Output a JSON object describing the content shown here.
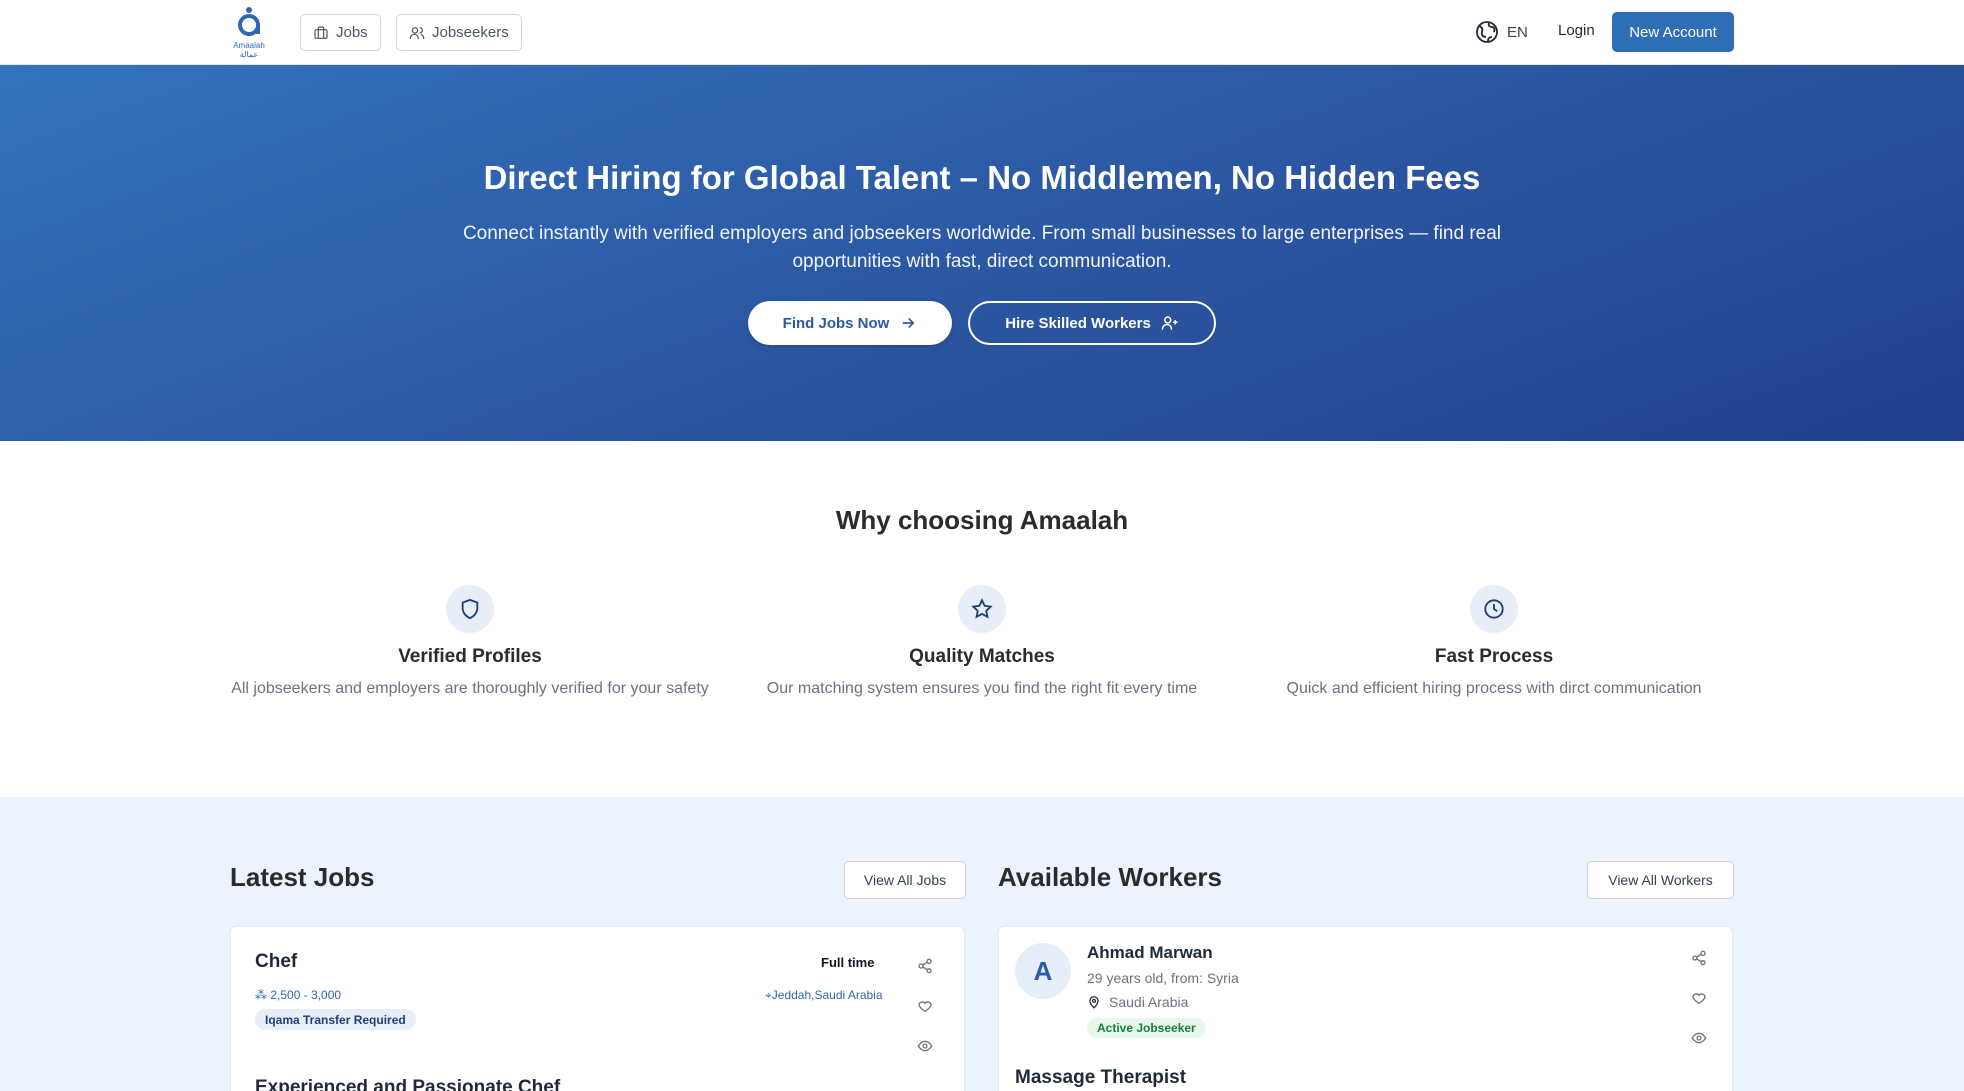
{
  "nav": {
    "logo_text_en": "Amaalah",
    "logo_text_ar": "عمالة",
    "jobs_label": "Jobs",
    "jobseekers_label": "Jobseekers",
    "language": "EN",
    "login_label": "Login",
    "new_account_label": "New Account"
  },
  "hero": {
    "title": "Direct Hiring for Global Talent – No Middlemen, No Hidden Fees",
    "subtitle": "Connect instantly with verified employers and jobseekers worldwide. From small businesses to large enterprises — find real opportunities with fast, direct communication.",
    "find_jobs_label": "Find Jobs Now",
    "hire_workers_label": "Hire Skilled Workers"
  },
  "why": {
    "title": "Why choosing Amaalah",
    "features": [
      {
        "icon": "shield-icon",
        "title": "Verified Profiles",
        "desc": "All jobseekers and employers are thoroughly verified for your safety"
      },
      {
        "icon": "star-icon",
        "title": "Quality Matches",
        "desc": "Our matching system ensures you find the right fit every time"
      },
      {
        "icon": "clock-icon",
        "title": "Fast Process",
        "desc": "Quick and efficient hiring process with dirct communication"
      }
    ]
  },
  "jobs": {
    "title": "Latest Jobs",
    "view_all_label": "View All Jobs",
    "items": [
      {
        "title": "Chef",
        "salary": "2,500 - 3,000",
        "tag": "Iqama Transfer Required",
        "type": "Full time",
        "location": "Jeddah,Saudi Arabia",
        "heading": "Experienced and Passionate Chef"
      }
    ]
  },
  "workers": {
    "title": "Available Workers",
    "view_all_label": "View All Workers",
    "items": [
      {
        "initial": "A",
        "name": "Ahmad Marwan",
        "age_origin": "29 years old, from: Syria",
        "location": "Saudi Arabia",
        "status": "Active Jobseeker",
        "role": "Massage Therapist"
      }
    ]
  },
  "colors": {
    "brand": "#2f6db5",
    "hero_start": "#3372bd",
    "hero_end": "#223f8b",
    "section_bg": "#edf3fd",
    "active_green": "#15803d"
  }
}
